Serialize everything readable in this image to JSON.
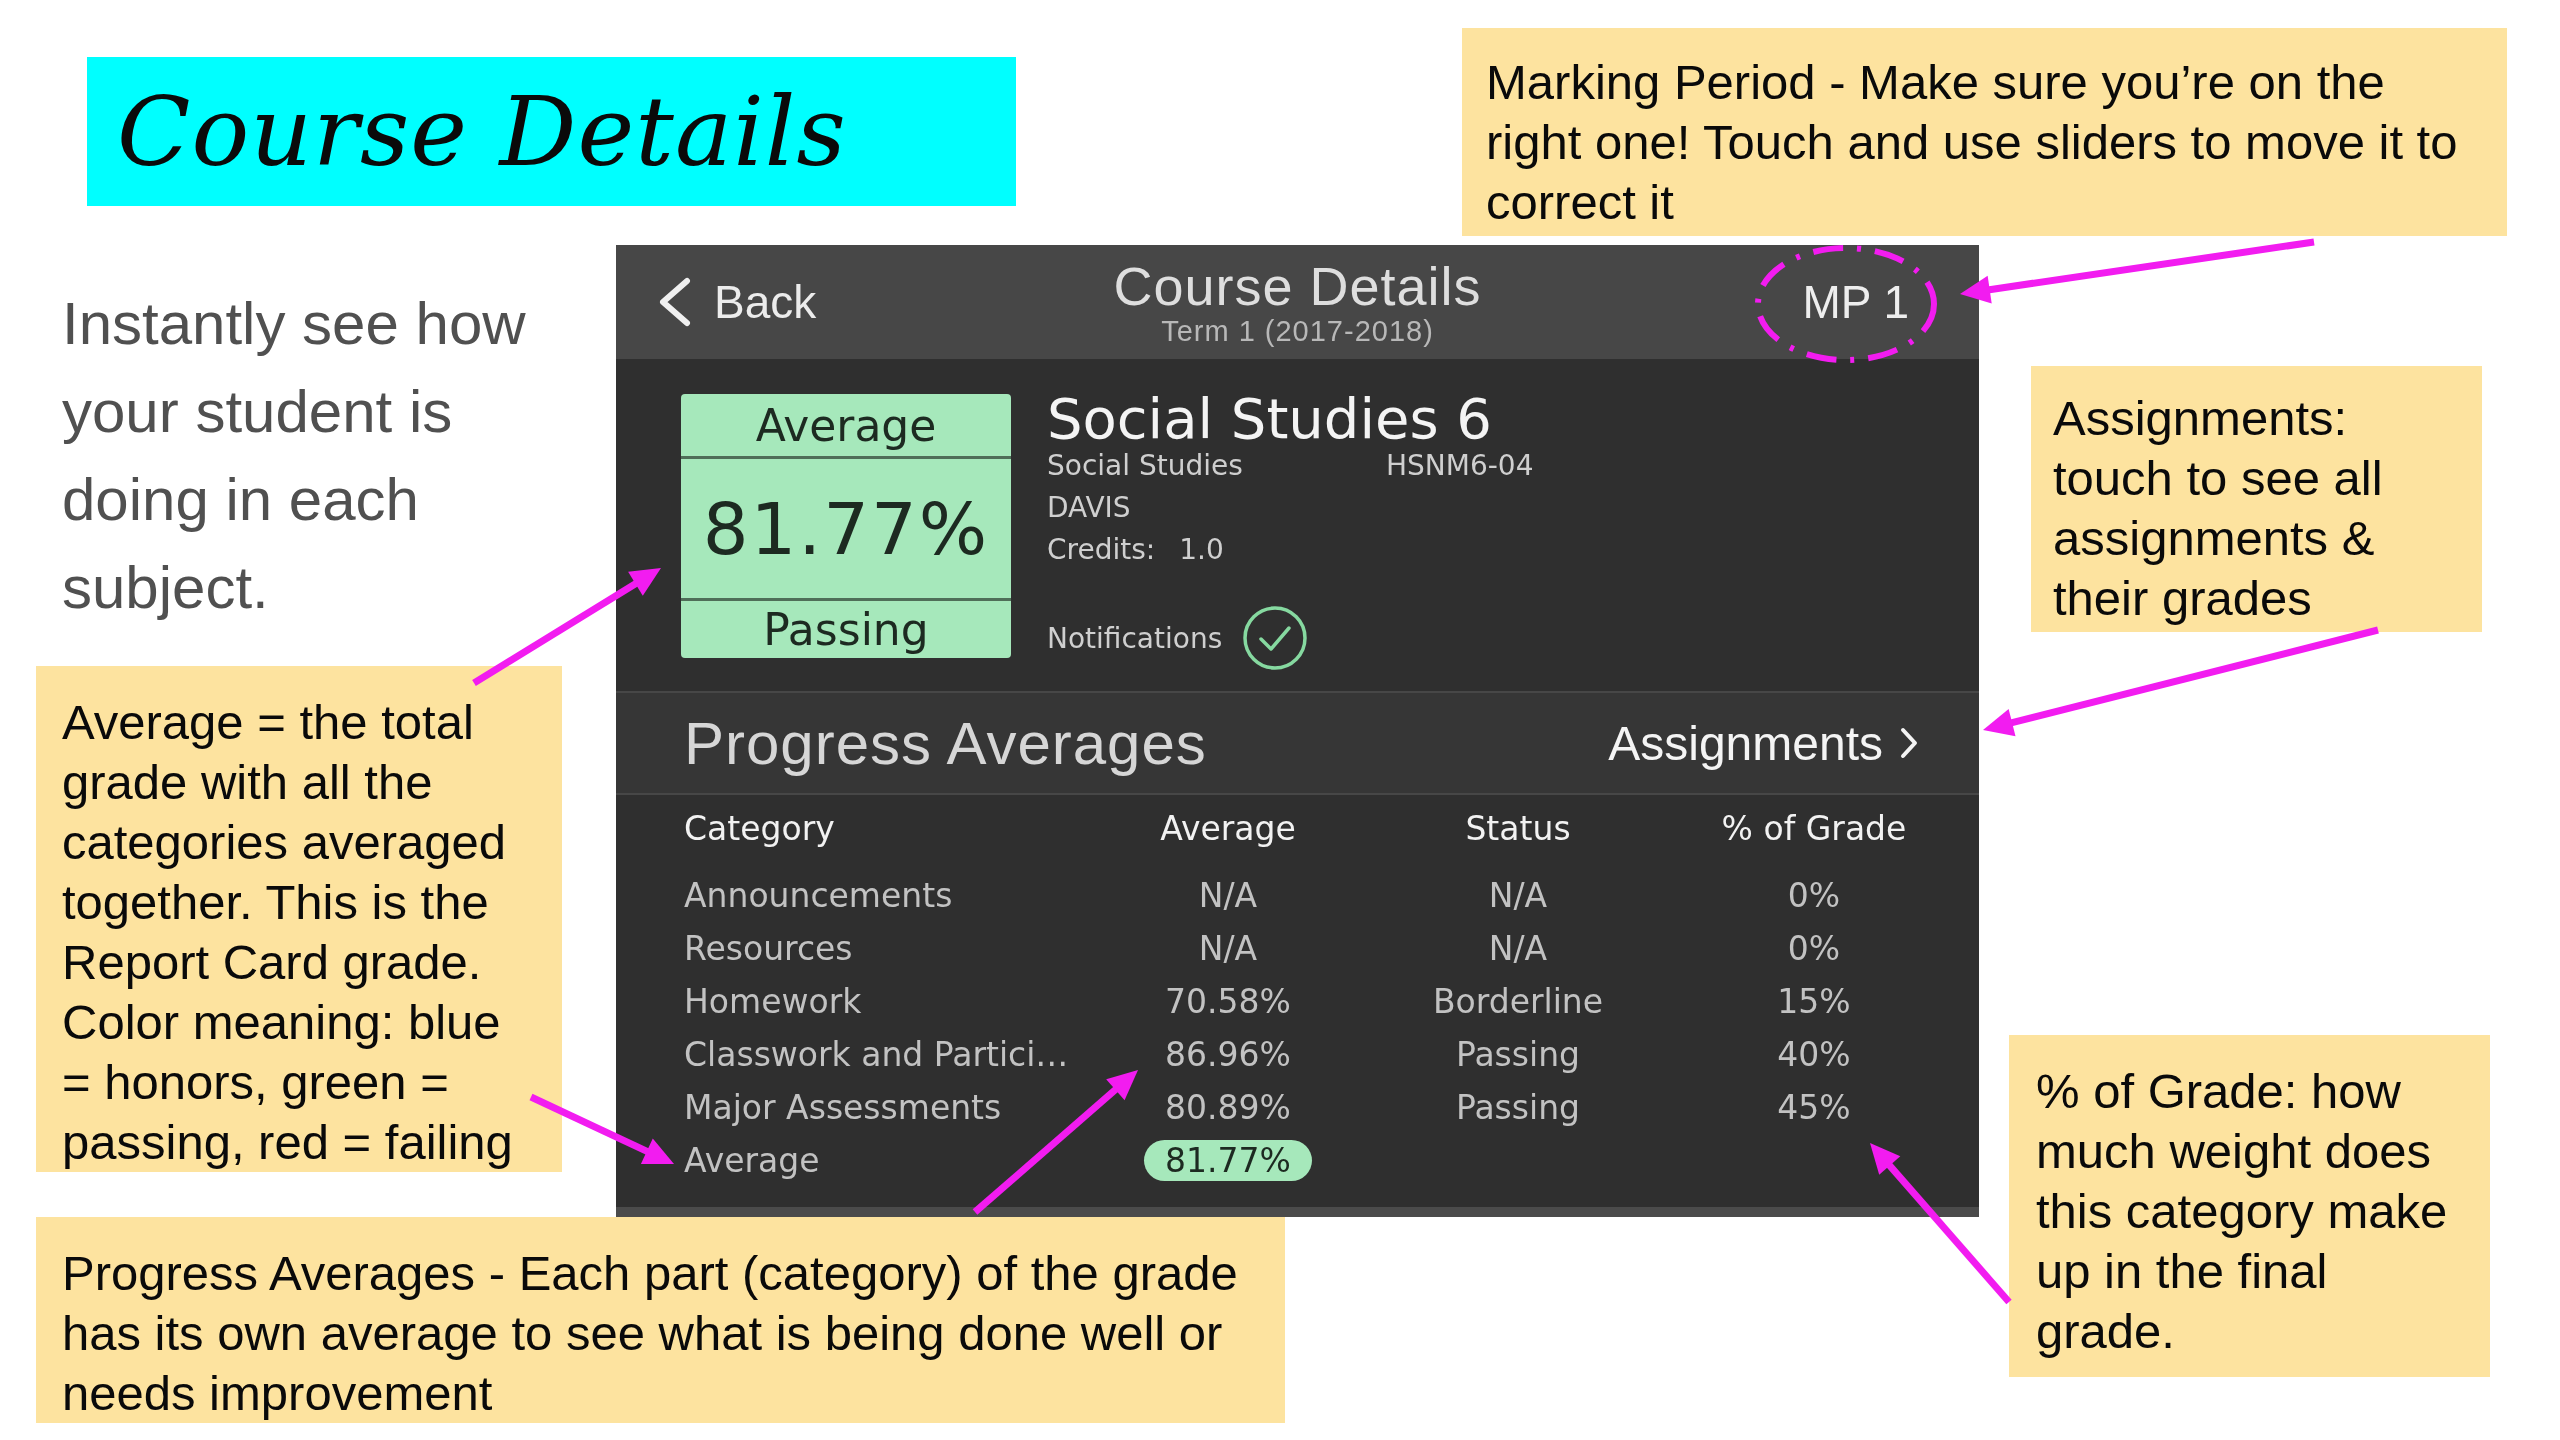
{
  "title_banner": "Course Details",
  "intro_text": "Instantly see how your student is doing in each subject.",
  "app_screen": {
    "header": {
      "back_label": "Back",
      "title": "Course Details",
      "subtitle": "Term 1 (2017-2018)",
      "marking_period": "MP 1"
    },
    "average_card": {
      "label": "Average",
      "value": "81.77%",
      "status": "Passing"
    },
    "course": {
      "name": "Social Studies 6",
      "subject": "Social Studies",
      "section": "HSNM6-04",
      "teacher": "DAVIS",
      "credits_label": "Credits:",
      "credits": "1.0",
      "notifications_label": "Notifications",
      "notifications_on": true
    },
    "progress_averages": {
      "title": "Progress Averages",
      "assignments_link": "Assignments",
      "columns": [
        "Category",
        "Average",
        "Status",
        "% of Grade"
      ],
      "rows": [
        {
          "category": "Announcements",
          "average": "N/A",
          "status": "N/A",
          "percent_of_grade": "0%"
        },
        {
          "category": "Resources",
          "average": "N/A",
          "status": "N/A",
          "percent_of_grade": "0%"
        },
        {
          "category": "Homework",
          "average": "70.58%",
          "status": "Borderline",
          "percent_of_grade": "15%"
        },
        {
          "category": "Classwork and Partici…",
          "average": "86.96%",
          "status": "Passing",
          "percent_of_grade": "40%"
        },
        {
          "category": "Major Assessments",
          "average": "80.89%",
          "status": "Passing",
          "percent_of_grade": "45%"
        }
      ],
      "overall": {
        "label": "Average",
        "value": "81.77%"
      }
    }
  },
  "callouts": {
    "marking_period": "Marking Period - Make sure you’re on the right one! Touch and use sliders to move it to correct it",
    "assignments": "Assignments: touch to see all assignments & their grades",
    "average": "Average = the total grade with all the categories averaged together. This is the Report Card grade. Color meaning: blue = honors, green = passing, red = failing",
    "progress_averages": "Progress Averages - Each part (category) of the grade has its own average to see what is being done well or needs improvement",
    "percent_of_grade": "% of Grade: how much weight does this category make up in the final grade."
  }
}
